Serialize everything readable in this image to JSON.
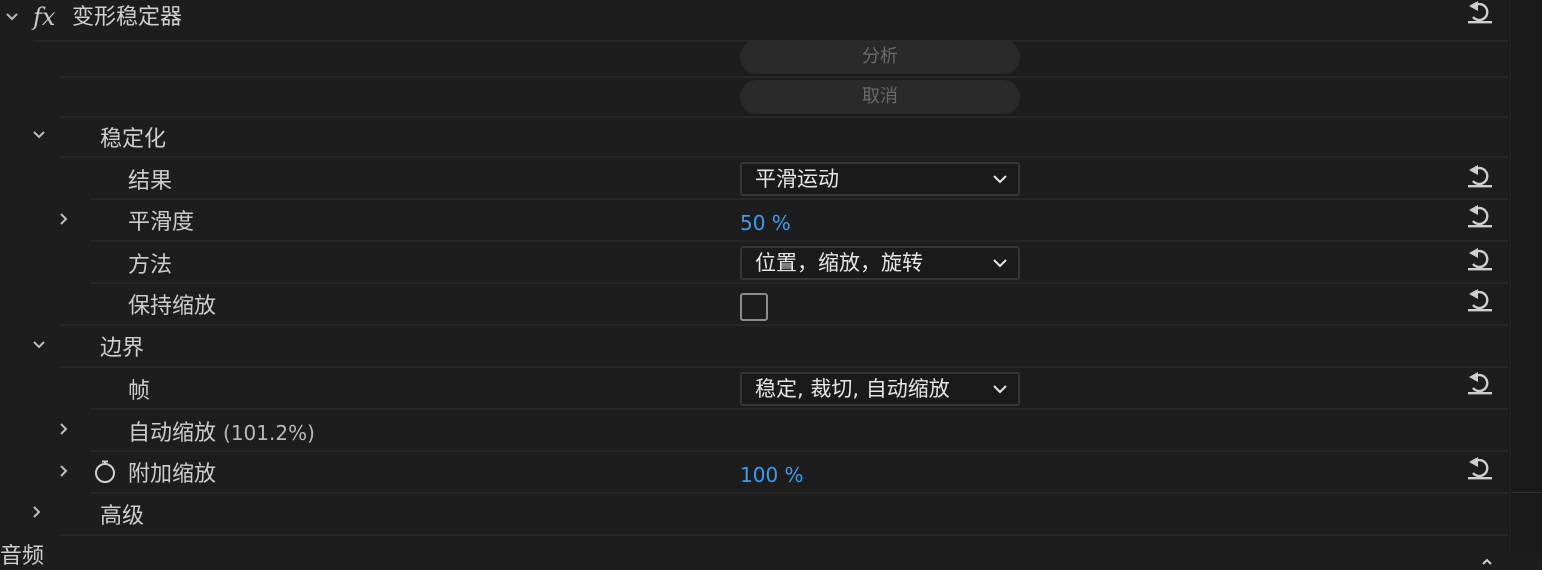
{
  "effect": {
    "fx_label": "fx",
    "name": "变形稳定器",
    "analyze_button": "分析",
    "cancel_button": "取消"
  },
  "stabilization": {
    "label": "稳定化",
    "result": {
      "label": "结果",
      "value": "平滑运动"
    },
    "smoothness": {
      "label": "平滑度",
      "value": "50 %"
    },
    "method": {
      "label": "方法",
      "value": "位置，缩放，旋转"
    },
    "preserve_scale": {
      "label": "保持缩放",
      "checked": false
    }
  },
  "borders": {
    "label": "边界",
    "framing": {
      "label": "帧",
      "value": "稳定, 裁切, 自动缩放"
    },
    "auto_scale": {
      "label": "自动缩放",
      "value": "(101.2%)"
    },
    "additional_scale": {
      "label": "附加缩放",
      "value": "100 %"
    }
  },
  "advanced": {
    "label": "高级"
  },
  "next_section": {
    "label": "音频"
  },
  "colors": {
    "background": "#1d1d1d",
    "value_blue": "#3d9cf0",
    "text": "#cfcfcf",
    "disabled_text": "#6a6a6a"
  }
}
